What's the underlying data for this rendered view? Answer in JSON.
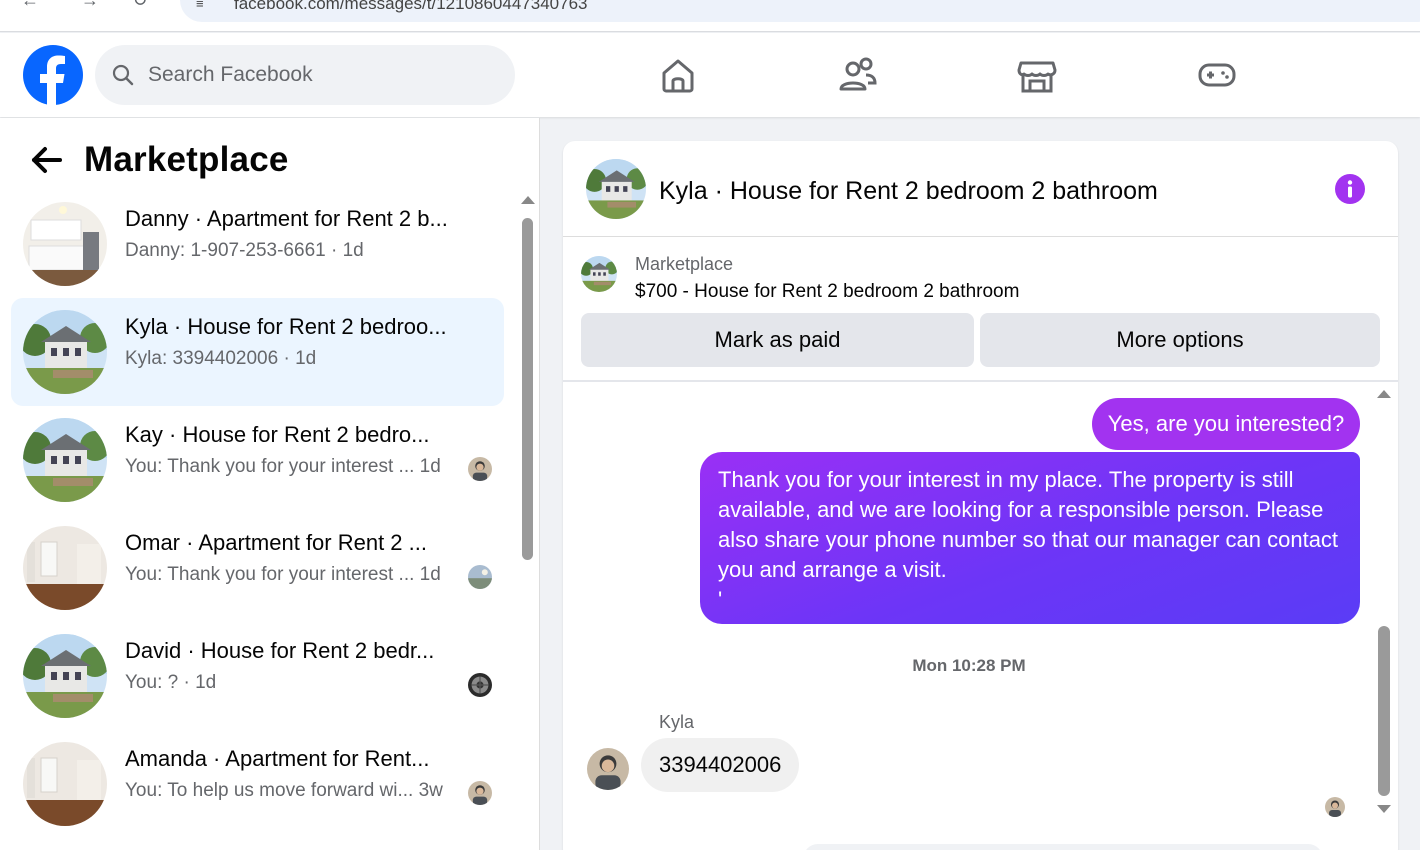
{
  "browser": {
    "url": "facebook.com/messages/t/1210860447340763",
    "back_icon": "arrow-left",
    "forward_icon": "arrow-right",
    "reload_icon": "reload"
  },
  "topnav": {
    "logo": "facebook-logo",
    "search_placeholder": "Search Facebook",
    "icons": [
      "home-icon",
      "friends-icon",
      "marketplace-icon",
      "gaming-icon"
    ]
  },
  "left_panel": {
    "title": "Marketplace",
    "conversations": [
      {
        "title": "Danny · Apartment for Rent 2 b...",
        "preview": "Danny: 1-907-253-6661 · 1d",
        "thumb": "kitchen",
        "active": false,
        "seen": null
      },
      {
        "title": "Kyla · House for Rent 2 bedroo...",
        "preview": "Kyla: 3394402006 · 1d",
        "thumb": "house",
        "active": true,
        "seen": null
      },
      {
        "title": "Kay · House for Rent 2 bedro...",
        "preview": "You: Thank you for your interest ...  1d",
        "thumb": "house",
        "active": false,
        "seen": "person"
      },
      {
        "title": "Omar · Apartment for Rent 2 ...",
        "preview": "You: Thank you for your interest ...  1d",
        "thumb": "room",
        "active": false,
        "seen": "landscape"
      },
      {
        "title": "David · House for Rent 2 bedr...",
        "preview": "You: ? · 1d",
        "thumb": "house",
        "active": false,
        "seen": "wheel"
      },
      {
        "title": "Amanda · Apartment for Rent...",
        "preview": "You: To help us move forward wi...  3w",
        "thumb": "room",
        "active": false,
        "seen": "person"
      }
    ]
  },
  "chat": {
    "header_name": "Kyla · House for Rent 2 bedroom 2 bathroom",
    "info_icon": "info-icon",
    "marketplace_label": "Marketplace",
    "listing": "$700 - House for Rent 2 bedroom 2 bathroom",
    "mark_paid_label": "Mark as paid",
    "more_options_label": "More options",
    "messages": {
      "out_1": "Yes, are you interested?",
      "out_2": "Thank you for your interest in my place. The property is still available, and we are looking for a responsible person. Please also share your phone number so that our manager can contact you and arrange a visit.",
      "out_2_tail": "'",
      "timestamp": "Mon 10:28 PM",
      "sender": "Kyla",
      "in_1": "3394402006"
    }
  },
  "colors": {
    "brand": "#0866ff",
    "outgoing": "#a233f0",
    "outgoing_gradient_end": "#5a3cf6",
    "active_row": "#ebf5ff",
    "info": "#a233f0"
  }
}
